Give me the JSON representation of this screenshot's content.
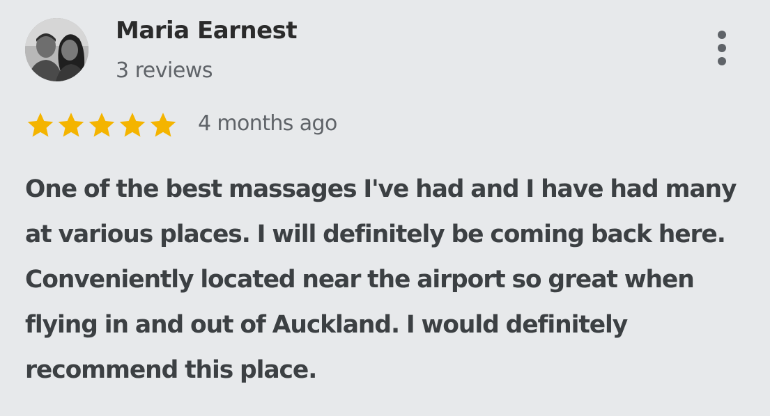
{
  "review": {
    "author_name": "Maria Earnest",
    "review_count": "3 reviews",
    "rating": 5,
    "rating_max": 5,
    "time_ago": "4 months ago",
    "text": "One of the best massages I've had and I have had many at various places. I will definitely be coming back here. Conveniently located near the airport so great when flying in and out of Auckland. I would definitely recommend this place."
  },
  "icons": {
    "avatar": "avatar-photo",
    "menu": "more-vertical-icon",
    "star": "star-icon"
  },
  "colors": {
    "background": "#e7e9eb",
    "star": "#f4b400",
    "author_text": "#2b2b2b",
    "meta_text": "#5f6368",
    "body_text": "#3c4043"
  }
}
